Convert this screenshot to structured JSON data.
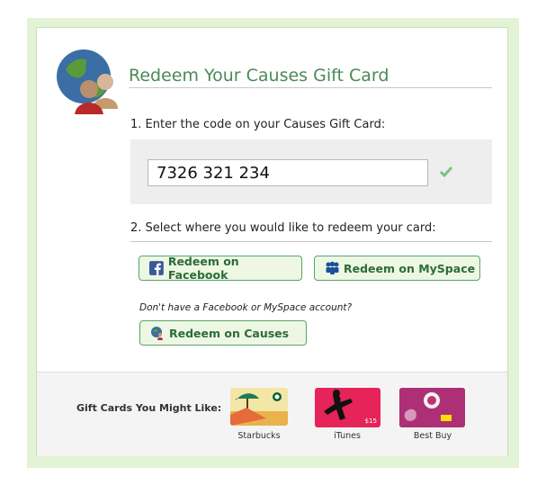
{
  "header": {
    "title": "Redeem Your Causes Gift Card"
  },
  "step1": {
    "label": "1. Enter the code on your Causes Gift Card:",
    "code_value": "7326 321 234"
  },
  "step2": {
    "label": "2. Select where you would like to redeem your card:",
    "facebook_button": "Redeem on Facebook",
    "myspace_button": "Redeem on MySpace",
    "no_account_text": "Don't have a Facebook or MySpace account?",
    "causes_button": "Redeem on Causes"
  },
  "footer": {
    "label": "Gift Cards You Might Like:",
    "cards": [
      {
        "name": "Starbucks"
      },
      {
        "name": "iTunes",
        "price": "$15"
      },
      {
        "name": "Best Buy"
      }
    ]
  },
  "colors": {
    "accent": "#4a8a55",
    "button_border": "#5aa36a",
    "background": "#e3f3d6"
  }
}
